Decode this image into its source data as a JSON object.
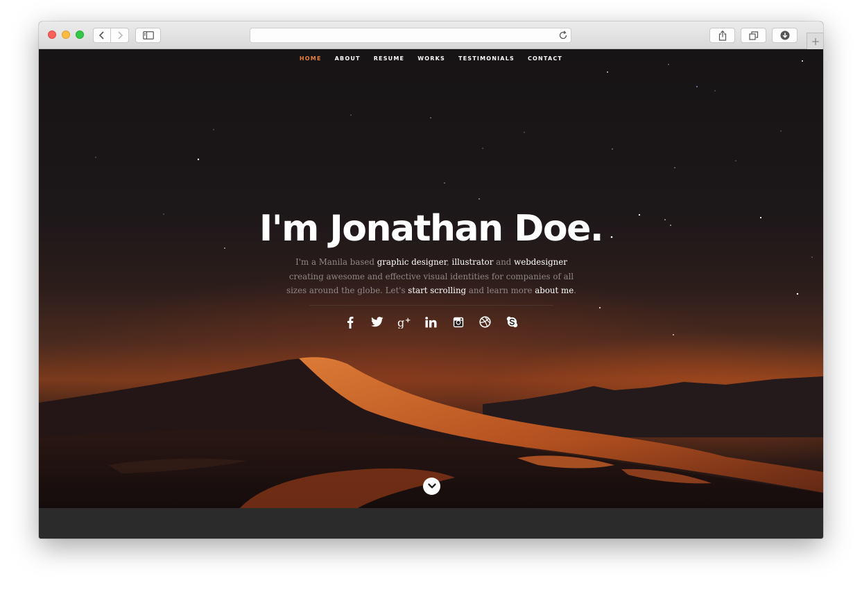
{
  "browser": {
    "address": "",
    "icons": {
      "back": "chevron-left-icon",
      "forward": "chevron-right-icon",
      "sidebar": "sidebar-icon",
      "reload": "reload-icon",
      "share": "share-icon",
      "tabs": "tabs-icon",
      "downloads": "download-icon",
      "new_tab": "plus-icon"
    }
  },
  "nav": {
    "items": [
      {
        "label": "HOME",
        "active": true
      },
      {
        "label": "ABOUT",
        "active": false
      },
      {
        "label": "RESUME",
        "active": false
      },
      {
        "label": "WORKS",
        "active": false
      },
      {
        "label": "TESTIMONIALS",
        "active": false
      },
      {
        "label": "CONTACT",
        "active": false
      }
    ],
    "active_color": "#e8803a"
  },
  "hero": {
    "headline": "I'm Jonathan Doe.",
    "intro": {
      "t1": "I'm a Manila based ",
      "l1": "graphic designer",
      "t2": ", ",
      "l2": "illustrator",
      "t3": " and ",
      "l3": "webdesigner",
      "t4": " creating awesome and effective visual identities for companies of all sizes around the globe. Let's ",
      "l4": "start scrolling",
      "t5": " and learn more ",
      "l5": "about me",
      "t6": "."
    },
    "social": [
      "facebook-icon",
      "twitter-icon",
      "google-plus-icon",
      "linkedin-icon",
      "instagram-icon",
      "dribbble-icon",
      "skype-icon"
    ],
    "scroll_icon": "chevron-down-icon"
  }
}
